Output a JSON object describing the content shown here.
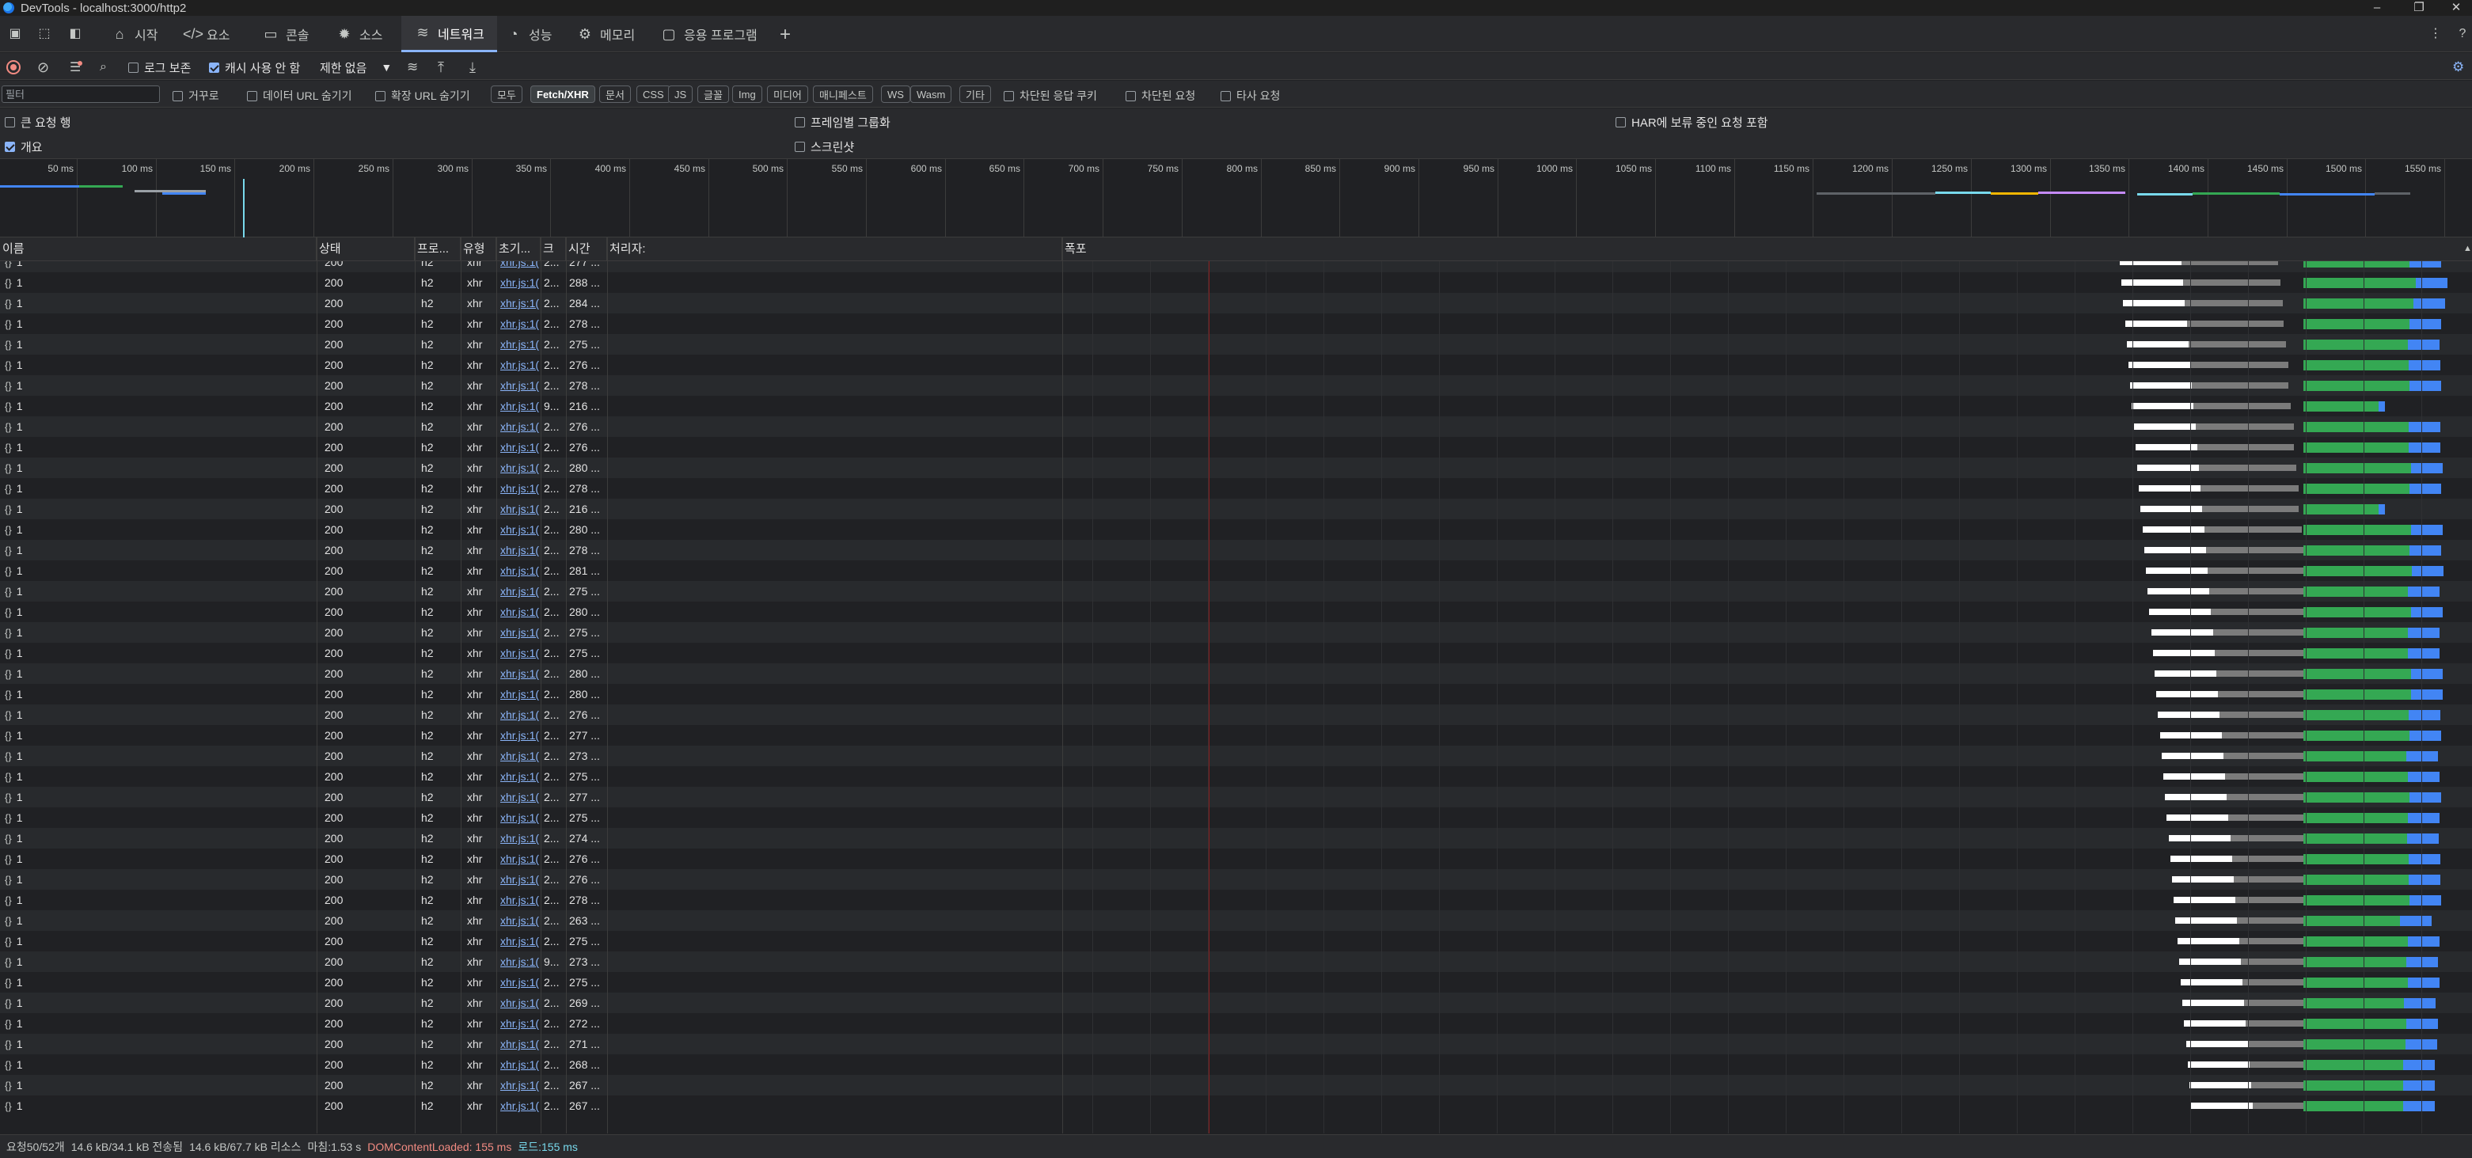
{
  "window": {
    "title": "DevTools - localhost:3000/http2",
    "min": "–",
    "restore": "❐",
    "close": "✕"
  },
  "tabs": [
    {
      "label": "시작",
      "icon": "⌂",
      "name": "tab-welcome"
    },
    {
      "label": "요소",
      "icon": "</>",
      "name": "tab-elements"
    },
    {
      "label": "콘솔",
      "icon": "▭",
      "name": "tab-console"
    },
    {
      "label": "소스",
      "icon": "✹",
      "name": "tab-sources"
    },
    {
      "label": "네트워크",
      "icon": "≋",
      "name": "tab-network",
      "active": true
    },
    {
      "label": "성능",
      "icon": "◔",
      "name": "tab-performance"
    },
    {
      "label": "메모리",
      "icon": "⚙",
      "name": "tab-memory"
    },
    {
      "label": "응용 프로그램",
      "icon": "▢",
      "name": "tab-application"
    }
  ],
  "toolbar": {
    "preserve_log": "로그 보존",
    "disable_cache": "캐시 사용 안 함",
    "throttle": "제한 없음",
    "throttle_arrow": "▼"
  },
  "filter": {
    "placeholder": "필터",
    "invert": "거꾸로",
    "hide_data_urls": "데이터 URL 숨기기",
    "hide_ext_urls": "확장 URL 숨기기",
    "types": [
      "모두",
      "Fetch/XHR",
      "문서",
      "CSS",
      "JS",
      "글꼴",
      "Img",
      "미디어",
      "매니페스트",
      "WS",
      "Wasm",
      "기타"
    ],
    "active_type": "Fetch/XHR",
    "blocked_cookies": "차단된 응답 쿠키",
    "blocked_requests": "차단된 요청",
    "third_party": "타사 요청"
  },
  "options": {
    "big_rows": "큰 요청 행",
    "overview": "개요",
    "group_by_frame": "프레임별 그룹화",
    "screenshots": "스크린샷",
    "har_pending": "HAR에 보류 중인 요청 포함"
  },
  "overview_ticks": [
    "50 ms",
    "100 ms",
    "150 ms",
    "200 ms",
    "250 ms",
    "300 ms",
    "350 ms",
    "400 ms",
    "450 ms",
    "500 ms",
    "550 ms",
    "600 ms",
    "650 ms",
    "700 ms",
    "750 ms",
    "800 ms",
    "850 ms",
    "900 ms",
    "950 ms",
    "1000 ms",
    "1050 ms",
    "1100 ms",
    "1150 ms",
    "1200 ms",
    "1250 ms",
    "1300 ms",
    "1350 ms",
    "1400 ms",
    "1450 ms",
    "1500 ms",
    "1550 ms"
  ],
  "columns": {
    "name": "이름",
    "status": "상태",
    "protocol": "프로...",
    "type": "유형",
    "initiator": "초기...",
    "size": "크",
    "time": "시간",
    "handler": "처리자:",
    "waterfall": "폭포"
  },
  "row_defaults": {
    "name": "1",
    "status": "200",
    "protocol": "h2",
    "type": "xhr",
    "initiator": "xhr.js:1(",
    "name_icon": "{}"
  },
  "rows": [
    {
      "size": "2...",
      "time": "277 ..."
    },
    {
      "size": "2...",
      "time": "288 ..."
    },
    {
      "size": "2...",
      "time": "284 ..."
    },
    {
      "size": "2...",
      "time": "278 ..."
    },
    {
      "size": "2...",
      "time": "275 ..."
    },
    {
      "size": "2...",
      "time": "276 ..."
    },
    {
      "size": "2...",
      "time": "278 ..."
    },
    {
      "size": "9...",
      "time": "216 ..."
    },
    {
      "size": "2...",
      "time": "276 ..."
    },
    {
      "size": "2...",
      "time": "276 ..."
    },
    {
      "size": "2...",
      "time": "280 ..."
    },
    {
      "size": "2...",
      "time": "278 ..."
    },
    {
      "size": "2...",
      "time": "216 ..."
    },
    {
      "size": "2...",
      "time": "280 ..."
    },
    {
      "size": "2...",
      "time": "278 ..."
    },
    {
      "size": "2...",
      "time": "281 ..."
    },
    {
      "size": "2...",
      "time": "275 ..."
    },
    {
      "size": "2...",
      "time": "280 ..."
    },
    {
      "size": "2...",
      "time": "275 ..."
    },
    {
      "size": "2...",
      "time": "275 ..."
    },
    {
      "size": "2...",
      "time": "280 ..."
    },
    {
      "size": "2...",
      "time": "280 ..."
    },
    {
      "size": "2...",
      "time": "276 ..."
    },
    {
      "size": "2...",
      "time": "277 ..."
    },
    {
      "size": "2...",
      "time": "273 ..."
    },
    {
      "size": "2...",
      "time": "275 ..."
    },
    {
      "size": "2...",
      "time": "277 ..."
    },
    {
      "size": "2...",
      "time": "275 ..."
    },
    {
      "size": "2...",
      "time": "274 ..."
    },
    {
      "size": "2...",
      "time": "276 ..."
    },
    {
      "size": "2...",
      "time": "276 ..."
    },
    {
      "size": "2...",
      "time": "278 ..."
    },
    {
      "size": "2...",
      "time": "263 ..."
    },
    {
      "size": "2...",
      "time": "275 ..."
    },
    {
      "size": "9...",
      "time": "273 ..."
    },
    {
      "size": "2...",
      "time": "275 ..."
    },
    {
      "size": "2...",
      "time": "269 ..."
    },
    {
      "size": "2...",
      "time": "272 ..."
    },
    {
      "size": "2...",
      "time": "271 ..."
    },
    {
      "size": "2...",
      "time": "268 ..."
    },
    {
      "size": "2...",
      "time": "267 ..."
    },
    {
      "size": "2...",
      "time": "267 ..."
    }
  ],
  "status_bar": {
    "requests": "요청50/52개",
    "transferred": "14.6 kB/34.1 kB 전송됨",
    "resources": "14.6 kB/67.7 kB 리소스",
    "finish": "마침:1.53 s",
    "dcl": "DOMContentLoaded: 155 ms",
    "load": "로드:155 ms"
  },
  "colors": {
    "accent": "#8ab4f8",
    "waiting": "#34a853",
    "download": "#4285f4",
    "dcl": "#f28b82",
    "load": "#78d9ec"
  }
}
